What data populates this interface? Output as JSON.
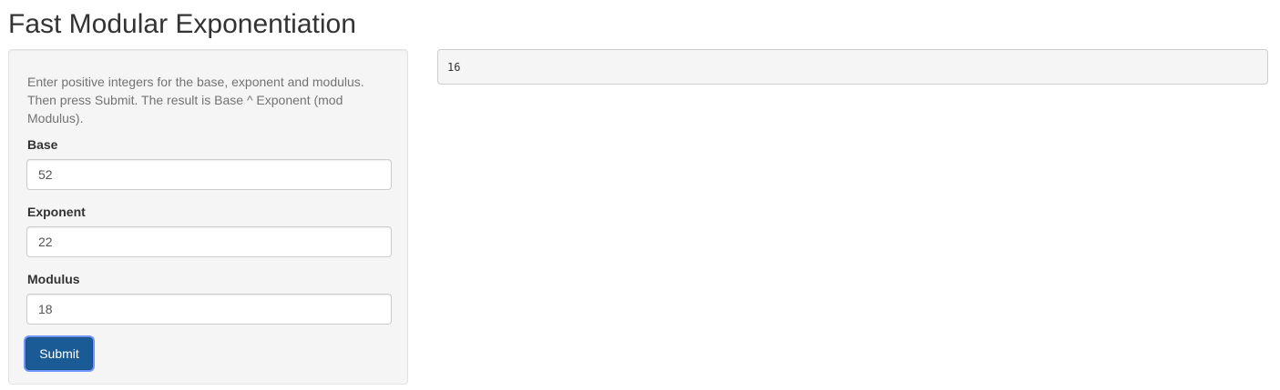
{
  "page": {
    "title": "Fast Modular Exponentiation"
  },
  "sidebar": {
    "help_text": "Enter positive integers for the base, exponent and modulus. Then press Submit. The result is Base ^ Exponent (mod Modulus).",
    "fields": {
      "base": {
        "label": "Base",
        "value": "52"
      },
      "exponent": {
        "label": "Exponent",
        "value": "22"
      },
      "modulus": {
        "label": "Modulus",
        "value": "18"
      }
    },
    "submit_label": "Submit"
  },
  "main": {
    "result": "16"
  },
  "colors": {
    "button_primary": "#1b5b95",
    "button_focus_ring": "#6f93ff",
    "panel_background": "#f5f5f5",
    "text_muted": "#737373"
  }
}
